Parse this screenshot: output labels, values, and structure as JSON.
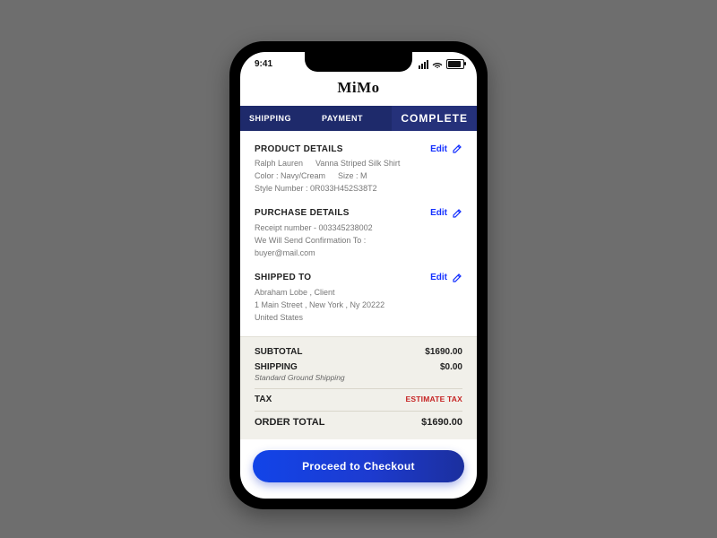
{
  "statusbar": {
    "time": "9:41"
  },
  "header": {
    "brand": "MiMo"
  },
  "tabs": [
    "SHIPPING",
    "PAYMENT",
    "COMPLETE"
  ],
  "labels": {
    "edit": "Edit"
  },
  "product": {
    "title": "PRODUCT DETAILS",
    "brand": "Ralph Lauren",
    "name": "Vanna Striped Silk Shirt",
    "colorLine": "Color : Navy/Cream",
    "sizeLine": "Size : M",
    "styleLine": "Style Number :  0R033H452S38T2"
  },
  "purchase": {
    "title": "PURCHASE DETAILS",
    "receiptLine": "Receipt number - 003345238002",
    "confirmLine": "We Will Send Confirmation To :",
    "email": "buyer@mail.com"
  },
  "ship": {
    "title": "SHIPPED TO",
    "nameLine": "Abraham Lobe , Client",
    "addressLine": "1 Main Street , New York , Ny 20222",
    "country": "United States"
  },
  "totals": {
    "subtotal": {
      "label": "SUBTOTAL",
      "value": "$1690.00"
    },
    "shipping": {
      "label": "SHIPPING",
      "note": "Standard Ground Shipping",
      "value": "$0.00"
    },
    "tax": {
      "label": "TAX",
      "estimate": "ESTIMATE TAX"
    },
    "order": {
      "label": "ORDER TOTAL",
      "value": "$1690.00"
    }
  },
  "cta": {
    "checkout": "Proceed to Checkout"
  }
}
